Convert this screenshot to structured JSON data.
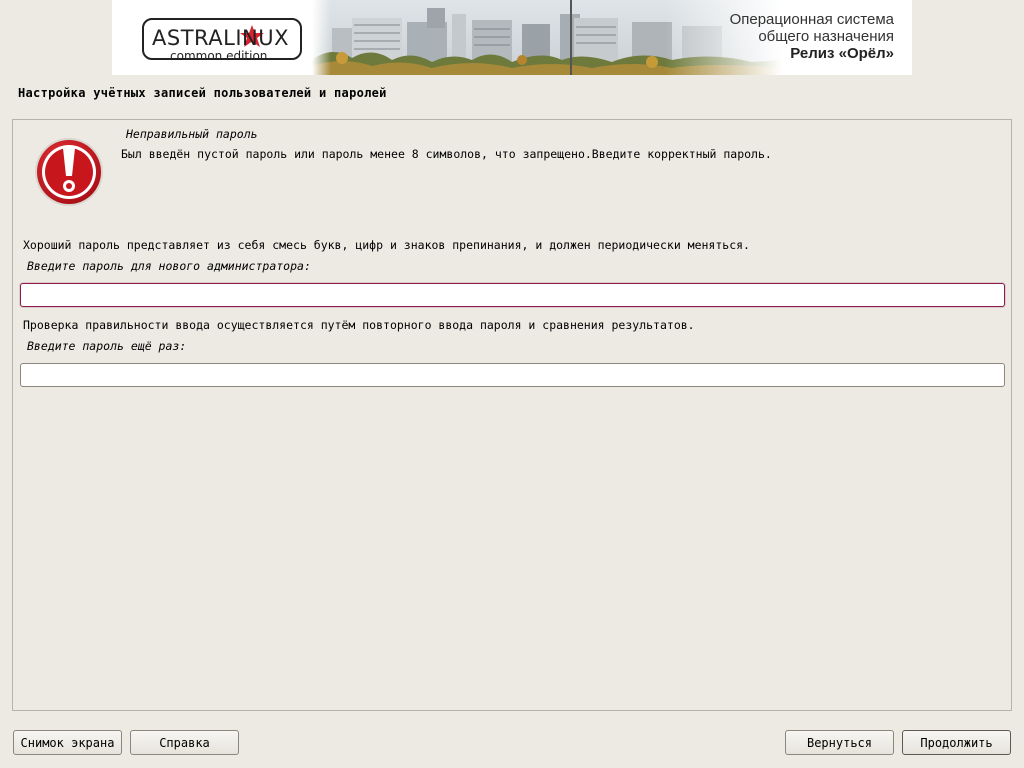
{
  "banner": {
    "logo_title": "ASTRALINUX",
    "logo_subtitle": "common edition",
    "os_line1": "Операционная система",
    "os_line2": "общего назначения",
    "release": "Релиз «Орёл»"
  },
  "page": {
    "title": "Настройка учётных записей пользователей и паролей"
  },
  "error": {
    "title": "Неправильный пароль",
    "message": "Был введён пустой пароль или пароль менее 8 символов, что запрещено.Введите корректный пароль."
  },
  "form": {
    "hint_password": "Хороший пароль представляет из себя смесь букв, цифр и знаков препинания, и должен периодически меняться.",
    "label_password": "Введите пароль для нового администратора:",
    "password_value": "",
    "hint_confirm": "Проверка правильности ввода осуществляется путём повторного ввода пароля и сравнения результатов.",
    "label_confirm": "Введите пароль ещё раз:",
    "confirm_value": ""
  },
  "buttons": {
    "screenshot": "Снимок экрана",
    "help": "Справка",
    "back": "Вернуться",
    "continue": "Продолжить"
  },
  "colors": {
    "background": "#edeae3",
    "focus_border": "#8a1d4d",
    "alert_red": "#c8161d",
    "star_red": "#d9232e"
  },
  "icons": {
    "alert": "exclamation-alert-icon",
    "logo_star": "star-icon"
  }
}
